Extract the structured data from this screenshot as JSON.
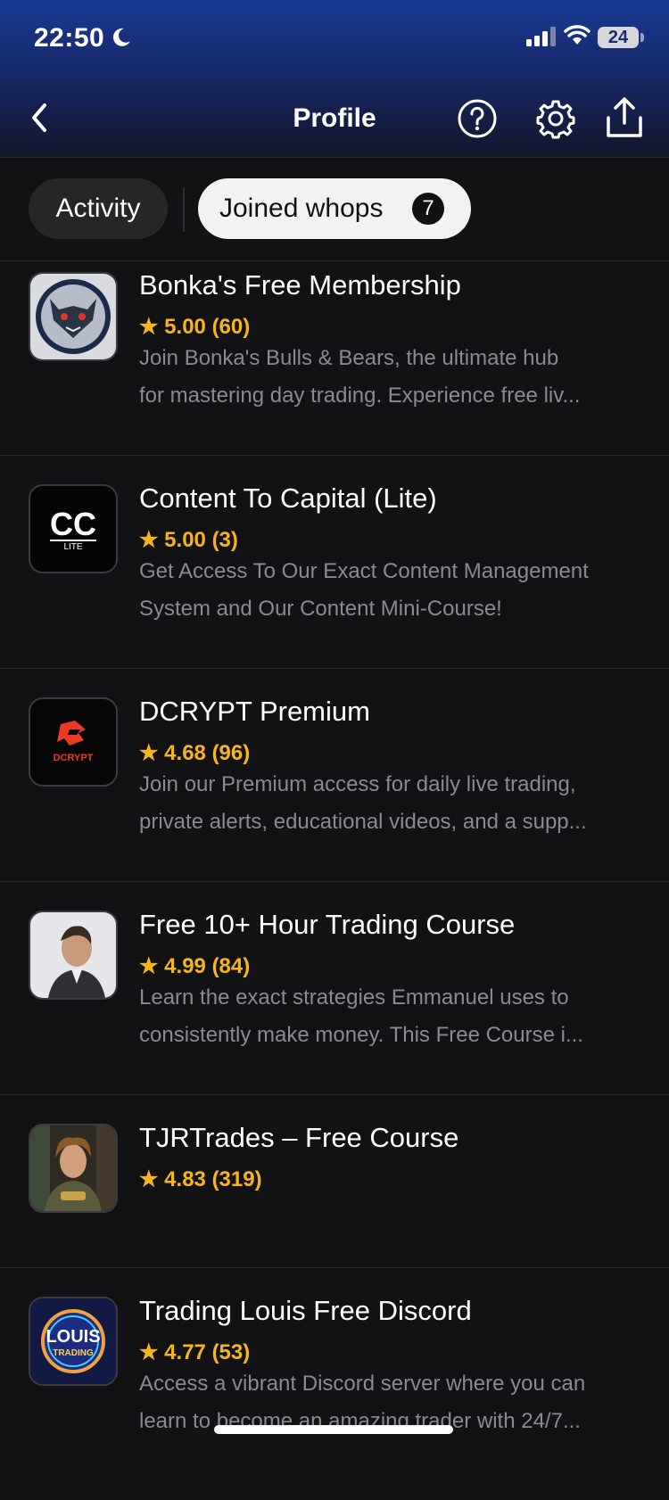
{
  "status": {
    "time": "22:50",
    "battery": "24"
  },
  "header": {
    "title": "Profile"
  },
  "tabs": {
    "activity": "Activity",
    "joined": "Joined whops",
    "joined_count": "7"
  },
  "items": [
    {
      "name": "Bonka's Free Membership",
      "rating": "★ 5.00 (60)",
      "desc1": "Join Bonka's Bulls & Bears, the ultimate hub",
      "desc2": "for mastering day trading. Experience free liv..."
    },
    {
      "name": "Content To Capital (Lite)",
      "rating": "★ 5.00 (3)",
      "desc1": "Get Access To Our Exact Content Management",
      "desc2": "System and Our Content Mini-Course!",
      "logo_text": "CC",
      "logo_sub": "LITE"
    },
    {
      "name": "DCRYPT Premium",
      "rating": "★ 4.68 (96)",
      "desc1": "Join our Premium access for daily live trading,",
      "desc2": "private alerts, educational videos, and a supp...",
      "logo_text": "DCRYPT"
    },
    {
      "name": "Free 10+ Hour Trading Course",
      "rating": "★ 4.99 (84)",
      "desc1": "Learn the exact strategies Emmanuel uses to",
      "desc2": "consistently make money. This Free Course i..."
    },
    {
      "name": "TJRTrades – Free Course",
      "rating": "★ 4.83 (319)"
    },
    {
      "name": "Trading Louis Free Discord",
      "rating": "★ 4.77 (53)",
      "desc1": "Access a vibrant Discord server where you can",
      "desc2": "learn to become an amazing trader with 24/7...",
      "logo_text": "LOUIS",
      "logo_sub": "TRADING"
    }
  ],
  "colors": {
    "rating": "#f6b51c",
    "background": "#121113",
    "header_top": "#1a3a93"
  }
}
